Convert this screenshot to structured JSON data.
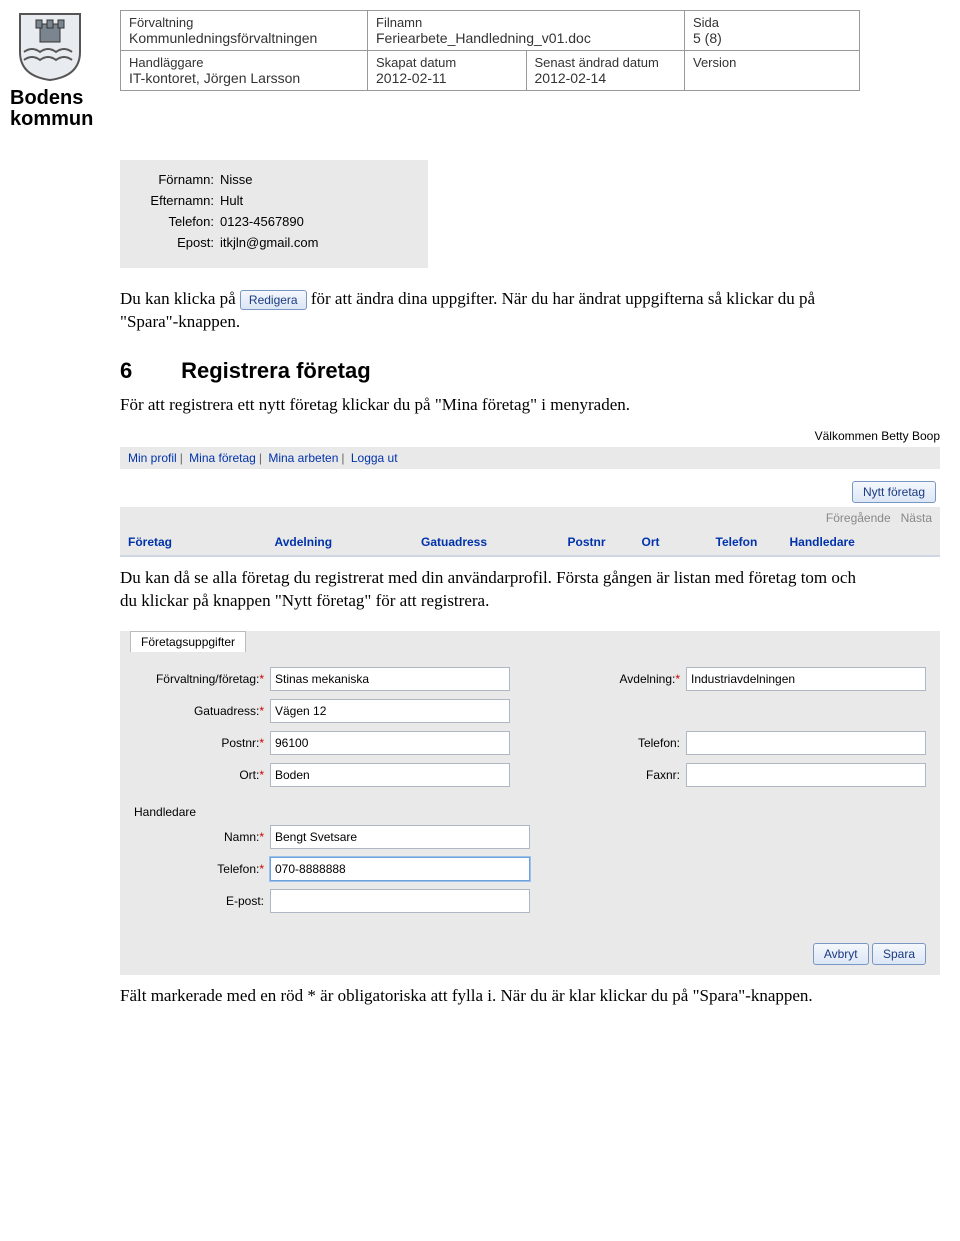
{
  "header": {
    "logo_text_1": "Bodens",
    "logo_text_2": "kommun",
    "labels": {
      "forvaltning": "Förvaltning",
      "filnamn": "Filnamn",
      "sida": "Sida",
      "handlaggare": "Handläggare",
      "skapat": "Skapat datum",
      "senast": "Senast ändrad datum",
      "version": "Version"
    },
    "values": {
      "forvaltning": "Kommunledningsförvaltningen",
      "filnamn": "Feriearbete_Handledning_v01.doc",
      "sida": "5 (8)",
      "handlaggare": "IT-kontoret, Jörgen Larsson",
      "skapat": "2012-02-11",
      "senast": "2012-02-14",
      "version": ""
    }
  },
  "profile": {
    "labels": {
      "fornamn": "Förnamn:",
      "efternamn": "Efternamn:",
      "telefon": "Telefon:",
      "epost": "Epost:"
    },
    "values": {
      "fornamn": "Nisse",
      "efternamn": "Hult",
      "telefon": "0123-4567890",
      "epost": "itkjln@gmail.com"
    }
  },
  "text": {
    "p1a": "Du kan klicka på ",
    "redigera": "Redigera",
    "p1b": " för att ändra dina uppgifter. När du har ändrat uppgifterna så klickar du på \"Spara\"-knappen.",
    "section_num": "6",
    "section_title": "Registrera företag",
    "p2": "För att registrera ett nytt företag klickar du på \"Mina företag\" i menyraden.",
    "p3": "Du kan då se alla företag du registrerat med din användarprofil. Första gången är listan med företag tom och du klickar på knappen \"Nytt företag\" för att registrera.",
    "p4": "Fält markerade med en röd * är obligatoriska att fylla i. När du är klar klickar du på \"Spara\"-knappen."
  },
  "app": {
    "welcome": "Välkommen Betty Boop",
    "menu": [
      "Min profil",
      "Mina företag",
      "Mina arbeten",
      "Logga ut"
    ],
    "new_company": "Nytt företag",
    "pager_prev": "Föregående",
    "pager_next": "Nästa",
    "columns": [
      "Företag",
      "Avdelning",
      "Gatuadress",
      "Postnr",
      "Ort",
      "Telefon",
      "Handledare"
    ]
  },
  "form": {
    "tab": "Företagsuppgifter",
    "labels": {
      "forvaltning": "Förvaltning/företag:",
      "avdelning": "Avdelning:",
      "gatuadress": "Gatuadress:",
      "postnr": "Postnr:",
      "telefon": "Telefon:",
      "ort": "Ort:",
      "faxnr": "Faxnr:",
      "handledare": "Handledare",
      "namn": "Namn:",
      "h_telefon": "Telefon:",
      "epost": "E-post:"
    },
    "values": {
      "forvaltning": "Stinas mekaniska",
      "avdelning": "Industriavdelningen",
      "gatuadress": "Vägen 12",
      "postnr": "96100",
      "telefon": "",
      "ort": "Boden",
      "faxnr": "",
      "namn": "Bengt Svetsare",
      "h_telefon": "070-8888888",
      "epost": ""
    },
    "cancel": "Avbryt",
    "save": "Spara"
  }
}
